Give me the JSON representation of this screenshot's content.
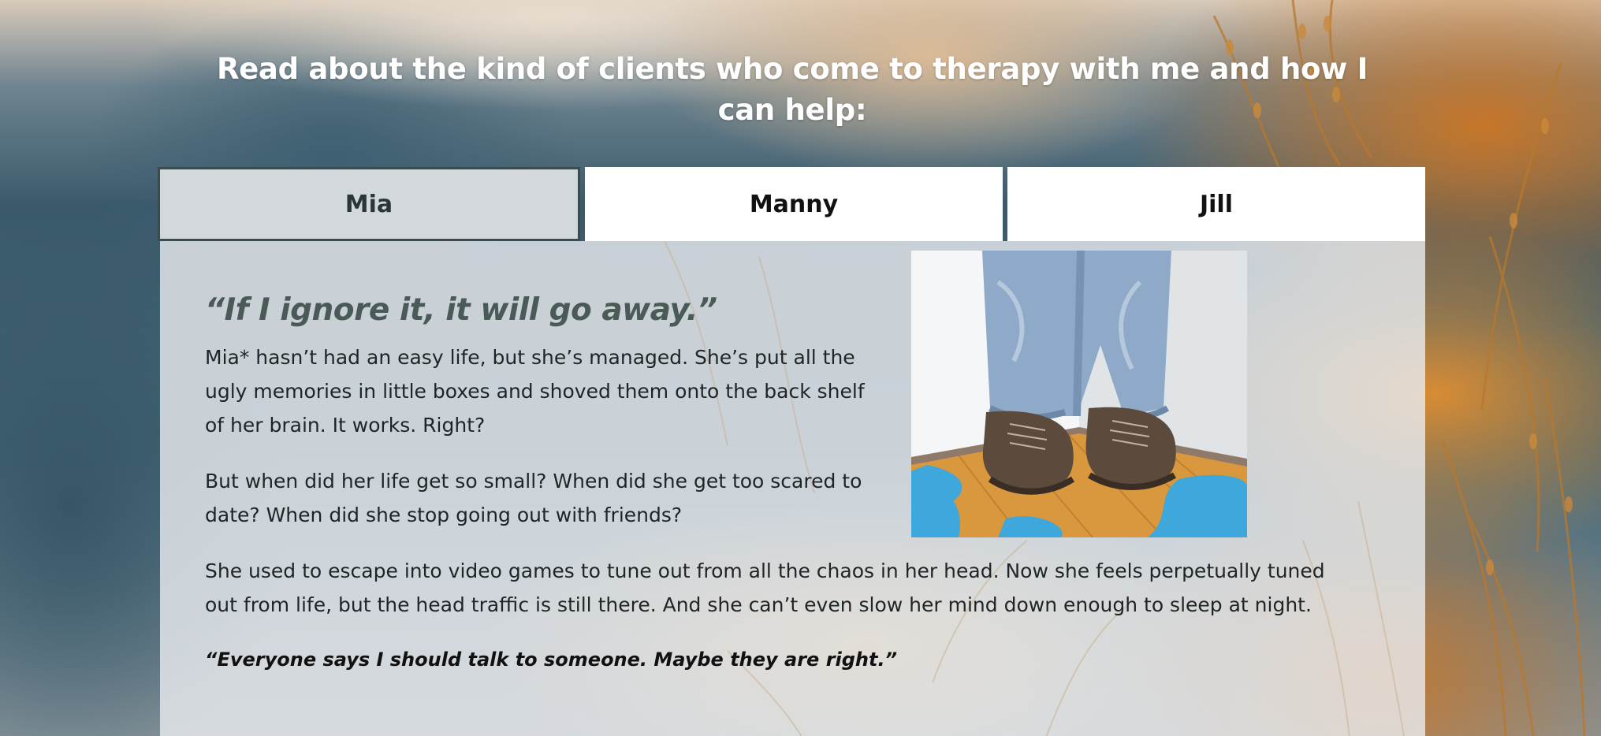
{
  "heading": "Read about the kind of clients who come to therapy with me and how I can help:",
  "tabs": [
    {
      "label": "Mia",
      "active": true
    },
    {
      "label": "Manny",
      "active": false
    },
    {
      "label": "Jill",
      "active": false
    }
  ],
  "panel": {
    "quote_title": "“If I ignore it, it will go away.”",
    "image_alt": "Person standing in a corner wearing jeans and brown shoes",
    "paragraphs": [
      "Mia* hasn’t had an easy life, but she’s managed. She’s put all the ugly memories in little boxes and shoved them onto the back shelf of her brain. It works. Right?",
      "But when did her life get so small? When did she get too scared to date? When did she stop going out with friends?",
      "She used to escape into video games to tune out from all the chaos in her head. Now she feels perpetually tuned out from life, but the head traffic is still there. And she can’t even slow her mind down enough to sleep at night."
    ],
    "pull_quote": "“Everyone says I should talk to someone. Maybe they are right.”"
  },
  "colors": {
    "active_tab_bg": "#d2d8dc",
    "active_tab_border": "#3c4b4d",
    "quote_title": "#4a5a56",
    "panel_bg": "#e8eaee"
  }
}
